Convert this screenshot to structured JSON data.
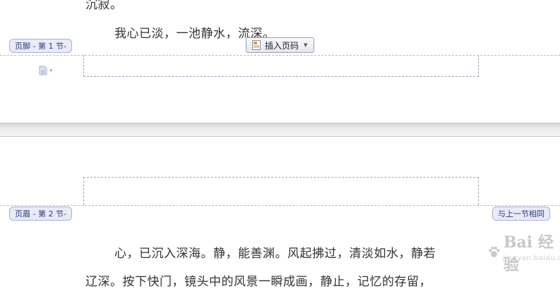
{
  "page1": {
    "lines": [
      "沉寂。",
      "我心已淡，一池静水，流深。"
    ],
    "footer_tab": "页脚 - 第 1 节-",
    "insert_page_number_button": "插入页码"
  },
  "page2": {
    "header_tab": "页眉 - 第 2 节-",
    "link_to_previous": "与上一节相同",
    "lines": [
      "心，已沉入深海。静，能善渊。风起拂过，清淡如水，静若",
      "辽深。按下快门，镜头中的风景一瞬成画，静止，记忆的存留，"
    ]
  },
  "watermark": {
    "logo": "Bai 经验",
    "url": "jingyan.baidu.com"
  },
  "colors": {
    "tab_bg": "#e8ebf8",
    "tab_border": "#a9afd6",
    "tab_text": "#2b3a78",
    "dashed": "#9ea3bb"
  },
  "icons": [
    "document-icon",
    "chevron-down-icon",
    "paw-logo-icon"
  ]
}
